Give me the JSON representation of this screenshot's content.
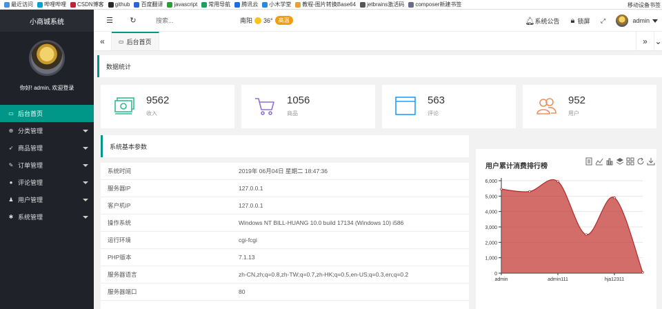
{
  "bookmarks": [
    {
      "label": "最近访问",
      "color": "#4a90e2"
    },
    {
      "label": "哔哩哔哩",
      "color": "#00a1d6"
    },
    {
      "label": "CSDN博客",
      "color": "#c32136"
    },
    {
      "label": "github",
      "color": "#24292e"
    },
    {
      "label": "百度翻译",
      "color": "#2b60de"
    },
    {
      "label": "javascript",
      "color": "#2e9c3a"
    },
    {
      "label": "常用导航",
      "color": "#19a15f"
    },
    {
      "label": "腾讯云",
      "color": "#1a6ce8"
    },
    {
      "label": "小木学堂",
      "color": "#2a88e3"
    },
    {
      "label": "教程-图片转换Base64",
      "color": "#e8a13a"
    },
    {
      "label": "jetbrains激活码",
      "color": "#555555"
    },
    {
      "label": "composer新建书签",
      "color": "#6a6a8a"
    }
  ],
  "bookmarks_other": "移动设备书签",
  "sidebar": {
    "title": "小商城系统",
    "welcome": "你好! admin, 欢迎登录",
    "items": [
      {
        "label": "后台首页",
        "icon": "monitor-icon",
        "glyph": "▭",
        "has_caret": false,
        "active": true
      },
      {
        "label": "分类管理",
        "icon": "category-icon",
        "glyph": "⊕",
        "has_caret": true,
        "active": false
      },
      {
        "label": "商品管理",
        "icon": "send-icon",
        "glyph": "➶",
        "has_caret": true,
        "active": false
      },
      {
        "label": "订单管理",
        "icon": "edit-icon",
        "glyph": "✎",
        "has_caret": true,
        "active": false
      },
      {
        "label": "评论管理",
        "icon": "comment-icon",
        "glyph": "●",
        "has_caret": true,
        "active": false
      },
      {
        "label": "用户管理",
        "icon": "users-icon",
        "glyph": "♟",
        "has_caret": true,
        "active": false
      },
      {
        "label": "系统管理",
        "icon": "gear-icon",
        "glyph": "✱",
        "has_caret": true,
        "active": false
      }
    ]
  },
  "header": {
    "search_placeholder": "搜索...",
    "weather_city": "南阳",
    "weather_temp": "36°",
    "weather_badge": "高温",
    "notice": "系统公告",
    "lock": "锁屏",
    "username": "admin"
  },
  "tabs": {
    "home": "后台首页"
  },
  "stats_title": "数据统计",
  "cards": [
    {
      "value": "9562",
      "label": "收入",
      "icon": "money-icon",
      "color": "#2ebd8f"
    },
    {
      "value": "1056",
      "label": "商品",
      "icon": "cart-icon",
      "color": "#8e6fd6"
    },
    {
      "value": "563",
      "label": "评论",
      "icon": "browser-icon",
      "color": "#1e9fff"
    },
    {
      "value": "952",
      "label": "用户",
      "icon": "users-icon",
      "color": "#f08f5a"
    }
  ],
  "params_title": "系统基本参数",
  "params": [
    {
      "key": "系统时间",
      "value": "2019年 06月04日 星期二 18:47:36"
    },
    {
      "key": "服务器IP",
      "value": "127.0.0.1"
    },
    {
      "key": "客户机IP",
      "value": "127.0.0.1"
    },
    {
      "key": "操作系统",
      "value": "Windows NT BILL-HUANG 10.0 build 17134 (Windows 10) i586"
    },
    {
      "key": "运行环境",
      "value": "cgi-fcgi"
    },
    {
      "key": "PHP版本",
      "value": "7.1.13"
    },
    {
      "key": "服务器语言",
      "value": "zh-CN,zh;q=0.8,zh-TW;q=0.7,zh-HK;q=0.5,en-US;q=0.3,en;q=0.2"
    },
    {
      "key": "服务器端口",
      "value": "80"
    }
  ],
  "chart_title": "用户累计消费排行榜",
  "chart_tools": [
    "data-view-icon",
    "line-icon",
    "bar-icon",
    "stack-icon",
    "tiled-icon",
    "refresh-icon",
    "download-icon"
  ],
  "chart_data": {
    "type": "area",
    "title": "用户累计消费排行榜",
    "x_tick_labels": [
      "admin",
      "admin111",
      "hja12311"
    ],
    "values": [
      5450,
      5300,
      5950,
      2500,
      4900,
      50
    ],
    "ylim": [
      0,
      6000
    ],
    "y_ticks": [
      0,
      1000,
      2000,
      3000,
      4000,
      5000,
      6000
    ],
    "y_tick_labels": [
      "0",
      "1,000",
      "2,000",
      "3,000",
      "4,000",
      "5,000",
      "6,000"
    ],
    "grid": true,
    "color": "#c23531"
  }
}
